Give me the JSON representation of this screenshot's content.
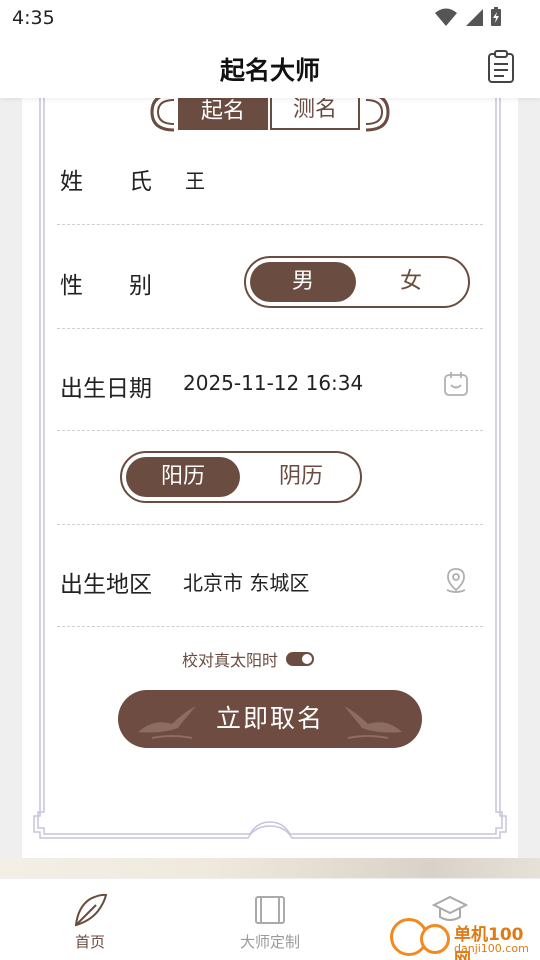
{
  "status_bar": {
    "time": "4:35"
  },
  "app_bar": {
    "title": "起名大师"
  },
  "tabs": {
    "active": "起名",
    "inactive": "测名"
  },
  "form": {
    "surname_label": "姓　　氏",
    "surname_value": "王",
    "gender_label": "性　　别",
    "gender_options": [
      "男",
      "女"
    ],
    "birth_date_label": "出生日期",
    "birth_date_value": "2025-11-12 16:34",
    "calendar_options": [
      "阳历",
      "阴历"
    ],
    "region_label": "出生地区",
    "region_value": "北京市 东城区",
    "true_solar_label": "校对真太阳时",
    "submit_label": "立即取名"
  },
  "bottom_nav": {
    "items": [
      {
        "label": "首页",
        "icon": "feather-icon"
      },
      {
        "label": "大师定制",
        "icon": "scroll-icon"
      },
      {
        "label": "",
        "icon": "graduation-cap-icon"
      }
    ]
  },
  "watermark": {
    "text": "单机100网",
    "sub": "danji100.com"
  },
  "colors": {
    "accent": "#6b4c40",
    "frame": "#c7c3dd",
    "background": "#efefef"
  }
}
